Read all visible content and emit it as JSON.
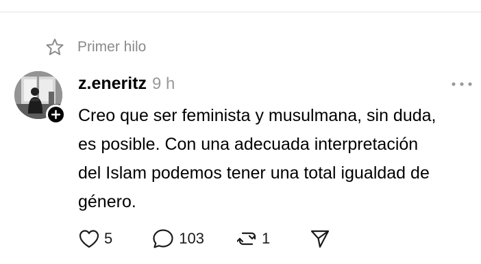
{
  "thread": {
    "label": "Primer hilo",
    "label_icon": "star-icon"
  },
  "post": {
    "username": "z.eneritz",
    "timestamp": "9 h",
    "body_lines": [
      "Creo que ser feminista y musulmana, sin duda,",
      "es posible. Con una adecuada interpretación",
      "del Islam podemos tener una total igualdad de",
      "género."
    ],
    "more_icon": "ellipsis-icon",
    "follow_icon": "plus-icon"
  },
  "actions": {
    "likes": "5",
    "replies": "103",
    "reposts": "1",
    "like_icon": "heart-icon",
    "reply_icon": "comment-bubble-icon",
    "repost_icon": "repost-icon",
    "share_icon": "send-icon"
  },
  "colors": {
    "text": "#000000",
    "muted": "#999999",
    "label": "#8a8a8a",
    "divider": "#e4e4e4",
    "background": "#ffffff"
  }
}
